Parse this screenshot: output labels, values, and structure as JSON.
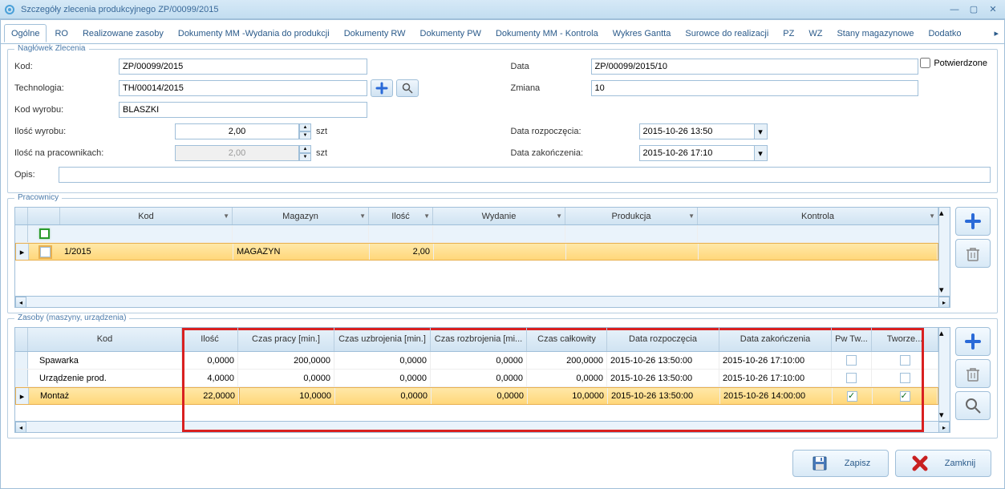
{
  "window": {
    "title": "Szczegóły zlecenia produkcyjnego ZP/00099/2015"
  },
  "tabs": [
    "Ogólne",
    "RO",
    "Realizowane zasoby",
    "Dokumenty MM -Wydania do produkcji",
    "Dokumenty RW",
    "Dokumenty PW",
    "Dokumenty MM - Kontrola",
    "Wykres Gantta",
    "Surowce do realizacji",
    "PZ",
    "WZ",
    "Stany magazynowe",
    "Dodatko"
  ],
  "header_group": "Nagłówek Zlecenia",
  "form": {
    "kod_label": "Kod:",
    "kod_value": "ZP/00099/2015",
    "data_label": "Data",
    "data_value": "ZP/00099/2015/10",
    "tech_label": "Technologia:",
    "tech_value": "TH/00014/2015",
    "zmiana_label": "Zmiana",
    "zmiana_value": "10",
    "kodw_label": "Kod wyrobu:",
    "kodw_value": "BLASZKI",
    "iloscw_label": "Ilość wyrobu:",
    "iloscw_value": "2,00",
    "iloscw_unit": "szt",
    "datarozp_label": "Data rozpoczęcia:",
    "datarozp_value": "2015-10-26 13:50",
    "iloscprac_label": "Ilość na pracownikach:",
    "iloscprac_value": "2,00",
    "iloscprac_unit": "szt",
    "datazak_label": "Data zakończenia:",
    "datazak_value": "2015-10-26 17:10",
    "opis_label": "Opis:",
    "opis_value": "",
    "potwierdzone_label": "Potwierdzone"
  },
  "pracownicy": {
    "title": "Pracownicy",
    "cols": [
      "",
      "",
      "Kod",
      "Magazyn",
      "Ilość",
      "Wydanie",
      "Produkcja",
      "Kontrola"
    ],
    "row": {
      "kod": "1/2015",
      "magazyn": "MAGAZYN",
      "ilosc": "2,00",
      "wydanie": "",
      "produkcja": "",
      "kontrola": ""
    }
  },
  "zasoby": {
    "title": "Zasoby (maszyny, urządzenia)",
    "cols": [
      "Kod",
      "Ilość",
      "Czas pracy [min.]",
      "Czas uzbrojenia  [min.]",
      "Czas rozbrojenia [mi...",
      "Czas całkowity",
      "Data rozpoczęcia",
      "Data zakończenia",
      "Pw Tw...",
      "Tworze..."
    ],
    "rows": [
      {
        "kod": "Spawarka",
        "ilosc": "0,0000",
        "czaspracy": "200,0000",
        "czasuzbr": "0,0000",
        "czasrozbr": "0,0000",
        "czascalc": "200,0000",
        "datarozp": "2015-10-26 13:50:00",
        "datazak": "2015-10-26 17:10:00",
        "pw": false,
        "tw": false
      },
      {
        "kod": "Urządzenie prod.",
        "ilosc": "4,0000",
        "czaspracy": "0,0000",
        "czasuzbr": "0,0000",
        "czasrozbr": "0,0000",
        "czascalc": "0,0000",
        "datarozp": "2015-10-26 13:50:00",
        "datazak": "2015-10-26 17:10:00",
        "pw": false,
        "tw": false
      },
      {
        "kod": "Montaż",
        "ilosc": "22,0000",
        "czaspracy": "10,0000",
        "czasuzbr": "0,0000",
        "czasrozbr": "0,0000",
        "czascalc": "10,0000",
        "datarozp": "2015-10-26 13:50:00",
        "datazak": "2015-10-26 14:00:00",
        "pw": true,
        "tw": true
      }
    ]
  },
  "buttons": {
    "save": "Zapisz",
    "close": "Zamknij"
  }
}
